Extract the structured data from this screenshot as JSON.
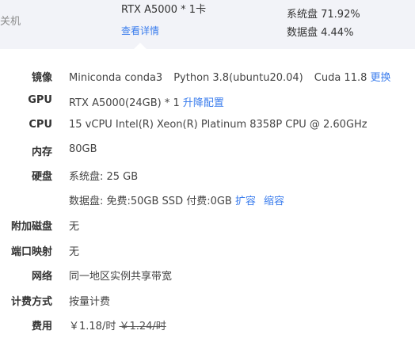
{
  "header": {
    "status": "关机",
    "gpu_model": "RTX A5000 * 1卡",
    "detail_link": "查看详情",
    "system_disk": "系统盘 71.92%",
    "data_disk": "数据盘 4.44%"
  },
  "details": {
    "image": {
      "label": "镜像",
      "env": "Miniconda conda3",
      "python": "Python 3.8(ubuntu20.04)",
      "cuda": "Cuda 11.8",
      "change_link": "更换"
    },
    "gpu": {
      "label": "GPU",
      "value": "RTX A5000(24GB) * 1",
      "upgrade_link": "升降配置"
    },
    "cpu": {
      "label": "CPU",
      "value": "15 vCPU Intel(R) Xeon(R) Platinum 8358P CPU @ 2.60GHz"
    },
    "memory": {
      "label": "内存",
      "value": "80GB"
    },
    "disk": {
      "label": "硬盘",
      "system": "系统盘:  25 GB",
      "data": "数据盘:  免费:50GB SSD  付费:0GB",
      "expand_link": "扩容",
      "shrink_link": "缩容"
    },
    "extra_disk": {
      "label": "附加磁盘",
      "value": "无"
    },
    "port_mapping": {
      "label": "端口映射",
      "value": "无"
    },
    "network": {
      "label": "网络",
      "value": "同一地区实例共享带宽"
    },
    "billing": {
      "label": "计费方式",
      "value": "按量计费"
    },
    "fee": {
      "label": "费用",
      "current": "￥1.18/时",
      "original": "￥1.24/时"
    }
  }
}
